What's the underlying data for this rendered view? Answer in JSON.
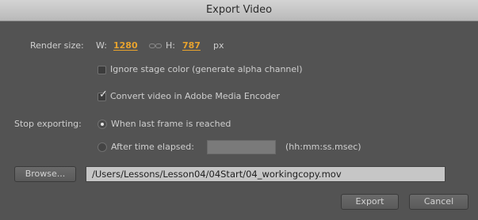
{
  "window": {
    "title": "Export Video"
  },
  "render_size": {
    "label": "Render size:",
    "width_label": "W:",
    "width_value": "1280",
    "height_label": "H:",
    "height_value": "787",
    "unit": "px"
  },
  "options": {
    "ignore_stage_color": {
      "label": "Ignore stage color (generate alpha channel)",
      "checked": false
    },
    "convert_in_ame": {
      "label": "Convert video in Adobe Media Encoder",
      "checked": true
    }
  },
  "stop_exporting": {
    "label": "Stop exporting:",
    "option_last_frame": "When last frame is reached",
    "option_time_elapsed": "After time elapsed:",
    "time_value": "",
    "time_format_hint": "(hh:mm:ss.msec)",
    "selected": "last_frame"
  },
  "file": {
    "browse_label": "Browse...",
    "path": "/Users/Lessons/Lesson04/04Start/04_workingcopy.mov"
  },
  "actions": {
    "export_label": "Export",
    "cancel_label": "Cancel"
  },
  "colors": {
    "background": "#535353",
    "accent": "#e8a32e",
    "titlebar": "#c8c8c8"
  }
}
